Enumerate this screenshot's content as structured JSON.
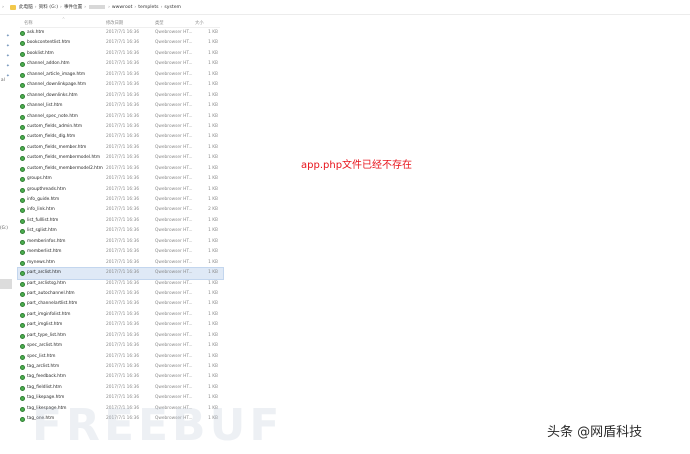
{
  "breadcrumb": {
    "items": [
      "此电脑",
      "资料 (G:)",
      "事件位置",
      "wwwroot",
      "templets",
      "system"
    ]
  },
  "columns": {
    "name": "名称",
    "date": "修改日期",
    "type": "类型",
    "size": "大小"
  },
  "files": [
    {
      "name": "ask.htm",
      "date": "2017/7/1 16:36",
      "type": "Qwebrowser HT...",
      "size": "1 KB"
    },
    {
      "name": "bookcontentlist.htm",
      "date": "2017/7/1 16:36",
      "type": "Qwebrowser HT...",
      "size": "1 KB"
    },
    {
      "name": "booklist.htm",
      "date": "2017/7/1 16:36",
      "type": "Qwebrowser HT...",
      "size": "1 KB"
    },
    {
      "name": "channel_addon.htm",
      "date": "2017/7/1 16:36",
      "type": "Qwebrowser HT...",
      "size": "1 KB"
    },
    {
      "name": "channel_article_image.htm",
      "date": "2017/7/1 16:36",
      "type": "Qwebrowser HT...",
      "size": "1 KB"
    },
    {
      "name": "channel_downlinkpage.htm",
      "date": "2017/7/1 16:36",
      "type": "Qwebrowser HT...",
      "size": "1 KB"
    },
    {
      "name": "channel_downlinks.htm",
      "date": "2017/7/1 16:36",
      "type": "Qwebrowser HT...",
      "size": "1 KB"
    },
    {
      "name": "channel_list.htm",
      "date": "2017/7/1 16:36",
      "type": "Qwebrowser HT...",
      "size": "1 KB"
    },
    {
      "name": "channel_spec_note.htm",
      "date": "2017/7/1 16:36",
      "type": "Qwebrowser HT...",
      "size": "1 KB"
    },
    {
      "name": "custom_fields_admin.htm",
      "date": "2017/7/1 16:36",
      "type": "Qwebrowser HT...",
      "size": "1 KB"
    },
    {
      "name": "custom_fields_dlg.htm",
      "date": "2017/7/1 16:36",
      "type": "Qwebrowser HT...",
      "size": "1 KB"
    },
    {
      "name": "custom_fields_member.htm",
      "date": "2017/7/1 16:36",
      "type": "Qwebrowser HT...",
      "size": "1 KB"
    },
    {
      "name": "custom_fields_membermodel.htm",
      "date": "2017/7/1 16:36",
      "type": "Qwebrowser HT...",
      "size": "1 KB"
    },
    {
      "name": "custom_fields_membermodel2.htm",
      "date": "2017/7/1 16:36",
      "type": "Qwebrowser HT...",
      "size": "1 KB"
    },
    {
      "name": "groups.htm",
      "date": "2017/7/1 16:36",
      "type": "Qwebrowser HT...",
      "size": "1 KB"
    },
    {
      "name": "groupthreads.htm",
      "date": "2017/7/1 16:36",
      "type": "Qwebrowser HT...",
      "size": "1 KB"
    },
    {
      "name": "info_guide.htm",
      "date": "2017/7/1 16:36",
      "type": "Qwebrowser HT...",
      "size": "1 KB"
    },
    {
      "name": "info_link.htm",
      "date": "2017/7/1 16:36",
      "type": "Qwebrowser HT...",
      "size": "2 KB"
    },
    {
      "name": "list_fulllist.htm",
      "date": "2017/7/1 16:36",
      "type": "Qwebrowser HT...",
      "size": "1 KB"
    },
    {
      "name": "list_sglist.htm",
      "date": "2017/7/1 16:36",
      "type": "Qwebrowser HT...",
      "size": "1 KB"
    },
    {
      "name": "memberinfos.htm",
      "date": "2017/7/1 16:36",
      "type": "Qwebrowser HT...",
      "size": "1 KB"
    },
    {
      "name": "memberlist.htm",
      "date": "2017/7/1 16:36",
      "type": "Qwebrowser HT...",
      "size": "1 KB"
    },
    {
      "name": "mynews.htm",
      "date": "2017/7/1 16:36",
      "type": "Qwebrowser HT...",
      "size": "1 KB"
    },
    {
      "name": "part_arclist.htm",
      "date": "2017/7/1 16:36",
      "type": "Qwebrowser HT...",
      "size": "1 KB"
    },
    {
      "name": "part_arclistsg.htm",
      "date": "2017/7/1 16:36",
      "type": "Qwebrowser HT...",
      "size": "1 KB"
    },
    {
      "name": "part_autochannel.htm",
      "date": "2017/7/1 16:36",
      "type": "Qwebrowser HT...",
      "size": "1 KB"
    },
    {
      "name": "part_channelartlist.htm",
      "date": "2017/7/1 16:36",
      "type": "Qwebrowser HT...",
      "size": "1 KB"
    },
    {
      "name": "part_imginfolist.htm",
      "date": "2017/7/1 16:36",
      "type": "Qwebrowser HT...",
      "size": "1 KB"
    },
    {
      "name": "part_imglist.htm",
      "date": "2017/7/1 16:36",
      "type": "Qwebrowser HT...",
      "size": "1 KB"
    },
    {
      "name": "part_type_list.htm",
      "date": "2017/7/1 16:36",
      "type": "Qwebrowser HT...",
      "size": "1 KB"
    },
    {
      "name": "spec_arclist.htm",
      "date": "2017/7/1 16:36",
      "type": "Qwebrowser HT...",
      "size": "1 KB"
    },
    {
      "name": "spec_list.htm",
      "date": "2017/7/1 16:36",
      "type": "Qwebrowser HT...",
      "size": "1 KB"
    },
    {
      "name": "tag_arclist.htm",
      "date": "2017/7/1 16:36",
      "type": "Qwebrowser HT...",
      "size": "1 KB"
    },
    {
      "name": "tag_feedback.htm",
      "date": "2017/7/1 16:36",
      "type": "Qwebrowser HT...",
      "size": "1 KB"
    },
    {
      "name": "tag_fieldlist.htm",
      "date": "2017/7/1 16:36",
      "type": "Qwebrowser HT...",
      "size": "1 KB"
    },
    {
      "name": "tag_likepage.htm",
      "date": "2017/7/1 16:36",
      "type": "Qwebrowser HT...",
      "size": "1 KB"
    },
    {
      "name": "tag_likespage.htm",
      "date": "2017/7/1 16:36",
      "type": "Qwebrowser HT...",
      "size": "1 KB"
    },
    {
      "name": "tag_one.htm",
      "date": "2017/7/1 16:36",
      "type": "Qwebrowser HT...",
      "size": "1 KB"
    }
  ],
  "selected_row": "part_arclist.htm",
  "left_pane": {
    "labels": [
      "al",
      "(G:)"
    ]
  },
  "annotation": {
    "text": "app.php文件已经不存在",
    "color": "#e8141c"
  },
  "watermarks": {
    "freebuf": "FREEBUF",
    "author": "头条 @网盾科技"
  },
  "icons": {
    "file": "qwebrowser-html-file-icon",
    "folder": "folder-icon"
  }
}
